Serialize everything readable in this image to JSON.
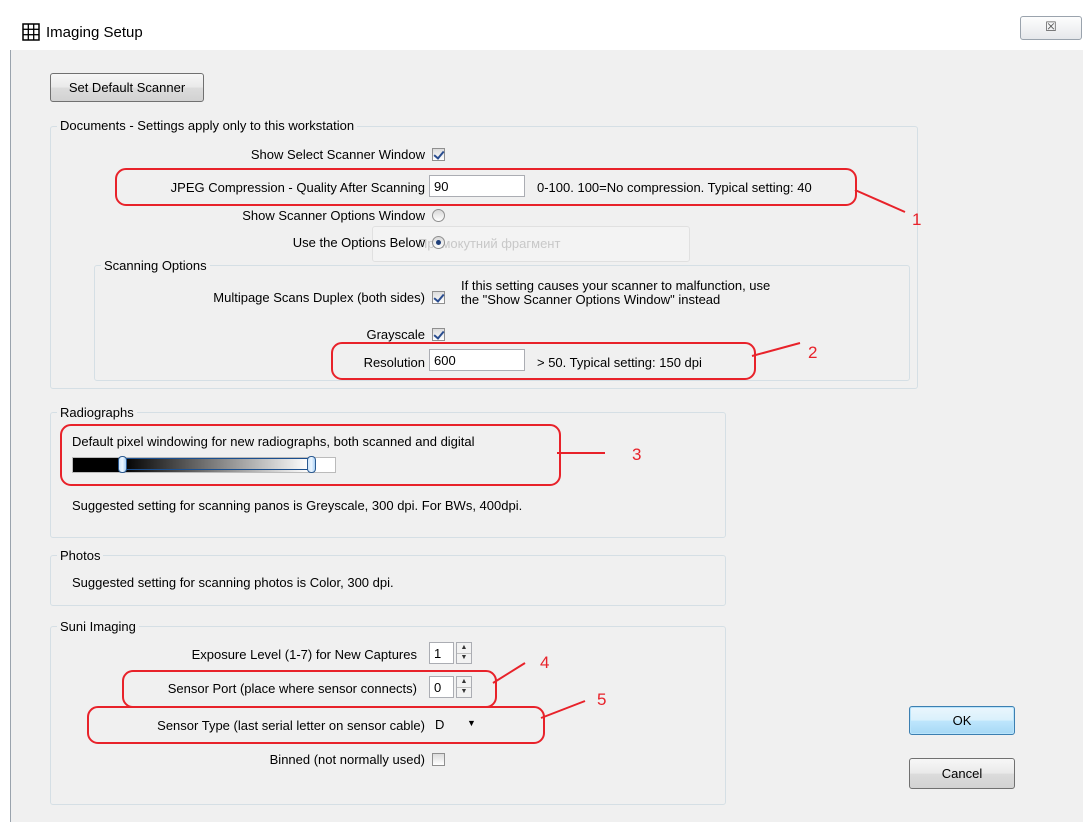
{
  "window": {
    "title": "Imaging Setup",
    "close_glyph": "☒"
  },
  "toolbar": {
    "set_default_scanner": "Set Default Scanner"
  },
  "documents": {
    "group_label": "Documents - Settings apply only to this workstation",
    "show_select_scanner_label": "Show Select Scanner Window",
    "show_select_scanner_checked": true,
    "jpeg_label": "JPEG Compression - Quality After Scanning",
    "jpeg_value": "90",
    "jpeg_hint": "0-100. 100=No compression.  Typical setting: 40",
    "show_options_label": "Show Scanner Options Window",
    "show_options_selected": false,
    "use_options_label": "Use the Options Below",
    "use_options_selected": true,
    "ghost_overlay_text": "Прямокутний фрагмент",
    "scanning_options": {
      "group_label": "Scanning Options",
      "duplex_label": "Multipage Scans Duplex (both sides)",
      "duplex_checked": true,
      "duplex_hint_line1": "If this setting causes your scanner to malfunction, use",
      "duplex_hint_line2": "the \"Show Scanner Options Window\" instead",
      "grayscale_label": "Grayscale",
      "grayscale_checked": true,
      "resolution_label": "Resolution",
      "resolution_value": "600",
      "resolution_hint": "> 50. Typical setting: 150 dpi"
    }
  },
  "radiographs": {
    "group_label": "Radiographs",
    "windowing_label": "Default pixel windowing for new radiographs, both scanned and digital",
    "windowing_low_fraction": 0.19,
    "windowing_high_fraction": 0.9,
    "suggestion": "Suggested setting for scanning panos is Greyscale, 300 dpi.  For BWs, 400dpi."
  },
  "photos": {
    "group_label": "Photos",
    "suggestion": "Suggested setting for scanning photos is Color, 300 dpi."
  },
  "suni": {
    "group_label": "Suni Imaging",
    "exposure_label": "Exposure Level (1-7) for New Captures",
    "exposure_value": "1",
    "sensor_port_label": "Sensor Port (place where sensor connects)",
    "sensor_port_value": "0",
    "sensor_type_label": "Sensor Type (last serial letter on sensor cable)",
    "sensor_type_value": "D",
    "binned_label": "Binned (not normally used)",
    "binned_checked": false
  },
  "dialog_buttons": {
    "ok": "OK",
    "cancel": "Cancel"
  },
  "annotations": [
    "1",
    "2",
    "3",
    "4",
    "5"
  ],
  "colors": {
    "annotation": "#e8222a",
    "primary_button": "#a7d9f5"
  }
}
